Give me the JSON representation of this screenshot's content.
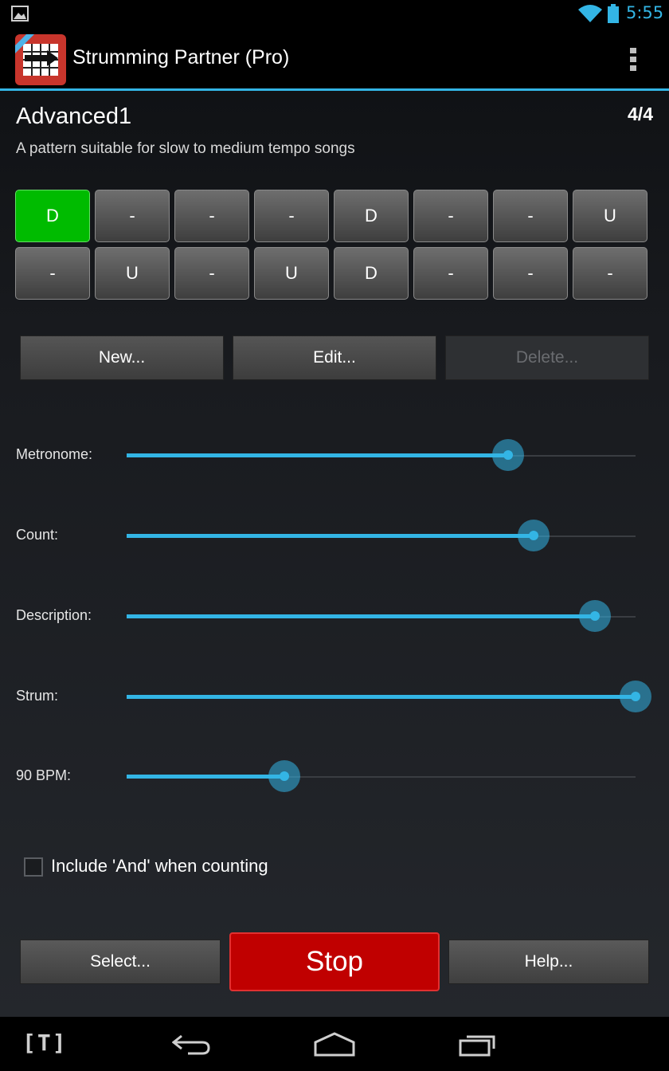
{
  "status_bar": {
    "time": "5:55",
    "icons": [
      "gallery-icon",
      "wifi-icon",
      "battery-icon"
    ],
    "accent": "#33b5e5"
  },
  "action_bar": {
    "title": "Strumming Partner (Pro)",
    "app_icon": "strumming-partner-app-icon",
    "overflow_icon": "overflow-menu-icon"
  },
  "pattern": {
    "name": "Advanced1",
    "time_signature": "4/4",
    "description": "A pattern suitable for slow to medium tempo songs",
    "rows": [
      [
        "D",
        "-",
        "-",
        "-",
        "D",
        "-",
        "-",
        "U"
      ],
      [
        "-",
        "U",
        "-",
        "U",
        "D",
        "-",
        "-",
        "-"
      ]
    ],
    "active_beat": {
      "row": 0,
      "col": 0
    },
    "active_color": "#00bb00"
  },
  "pattern_buttons": {
    "new": "New...",
    "edit": "Edit...",
    "delete": "Delete..."
  },
  "sliders": [
    {
      "label": "Metronome:",
      "value": 0.75
    },
    {
      "label": "Count:",
      "value": 0.8
    },
    {
      "label": "Description:",
      "value": 0.92
    },
    {
      "label": "Strum:",
      "value": 1.0
    },
    {
      "label": "90 BPM:",
      "value": 0.31
    }
  ],
  "counting": {
    "label": "Include 'And' when counting",
    "checked": false
  },
  "bottom_buttons": {
    "select": "Select...",
    "stop": "Stop",
    "help": "Help...",
    "stop_color": "#c00000"
  },
  "nav_bar": {
    "t_label": "[T]",
    "icons": [
      "back-icon",
      "home-icon",
      "recent-apps-icon"
    ]
  }
}
